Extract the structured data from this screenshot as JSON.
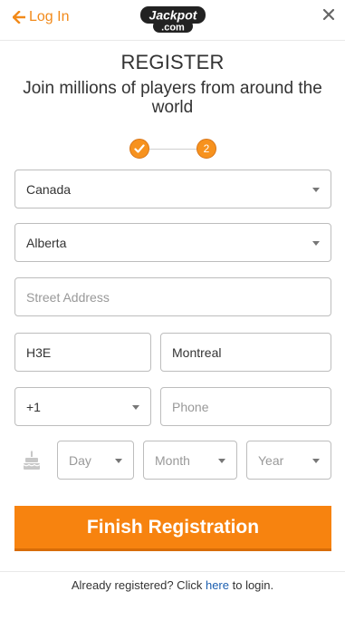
{
  "header": {
    "login_label": "Log In",
    "logo_top": "Jackpot",
    "logo_bottom": ".com",
    "accent_color": "#f28a1a"
  },
  "register": {
    "title": "REGISTER",
    "subtitle": "Join millions of players from around the world"
  },
  "steps": {
    "step1_icon": "checkmark-icon",
    "step2_label": "2"
  },
  "form": {
    "country_value": "Canada",
    "province_value": "Alberta",
    "street_placeholder": "Street Address",
    "postal_value": "H3E",
    "city_value": "Montreal",
    "phone_code_value": "+1",
    "phone_placeholder": "Phone",
    "birth_icon": "birthday-cake-icon",
    "day_placeholder": "Day",
    "month_placeholder": "Month",
    "year_placeholder": "Year"
  },
  "actions": {
    "finish_label": "Finish Registration",
    "button_color": "#f7830f"
  },
  "footer": {
    "text_before": "Already registered? Click ",
    "link_label": "here",
    "text_after": " to login."
  }
}
